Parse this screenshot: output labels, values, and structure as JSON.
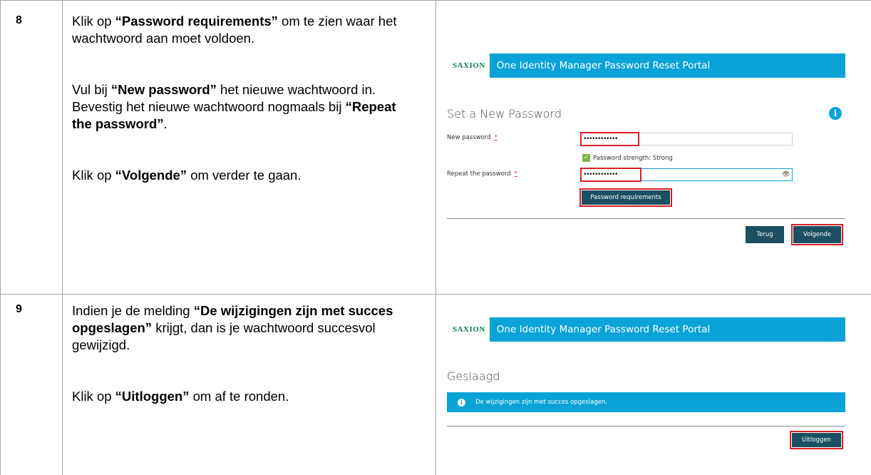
{
  "steps": [
    {
      "number": "8",
      "instructions": {
        "p1": {
          "pre": "Klik op ",
          "bold": "“Password requirements”",
          "post": " om te zien waar het wachtwoord aan moet voldoen."
        },
        "p2": {
          "pre": "Vul bij ",
          "bold1": "“New password”",
          "mid": " het nieuwe wachtwoord in. Bevestig het nieuwe wachtwoord nogmaals bij ",
          "bold2": "“Repeat the password”",
          "post": "."
        },
        "p3": {
          "pre": "Klik op ",
          "bold": "“Volgende”",
          "post": " om verder te gaan."
        }
      },
      "portal": {
        "logo": "SAXION",
        "title": "One Identity Manager Password Reset Portal",
        "heading": "Set a New Password",
        "new_password_label": "New password",
        "repeat_password_label": "Repeat the password",
        "required_mark": "*",
        "masked_value": "••••••••••••",
        "strength_text": "Password strength: Strong",
        "requirements_button": "Password requirements",
        "back_button": "Terug",
        "next_button": "Volgende"
      }
    },
    {
      "number": "9",
      "instructions": {
        "p1": {
          "pre": "Indien je de melding ",
          "bold": "“De wijzigingen zijn met succes opgeslagen”",
          "post": " krijgt, dan is je wachtwoord succesvol gewijzigd."
        },
        "p2": {
          "pre": "Klik op ",
          "bold": "“Uitloggen”",
          "post": " om af te ronden."
        }
      },
      "portal": {
        "logo": "SAXION",
        "title": "One Identity Manager Password Reset Portal",
        "heading": "Geslaagd",
        "banner_text": "De wijzigingen zijn met succes opgeslagen.",
        "logout_button": "Uitloggen"
      }
    }
  ],
  "colors": {
    "accent": "#0aa3d7",
    "button": "#1b4f62",
    "highlight": "#d6202a",
    "logo": "#0b7f49",
    "success": "#7ab648"
  }
}
